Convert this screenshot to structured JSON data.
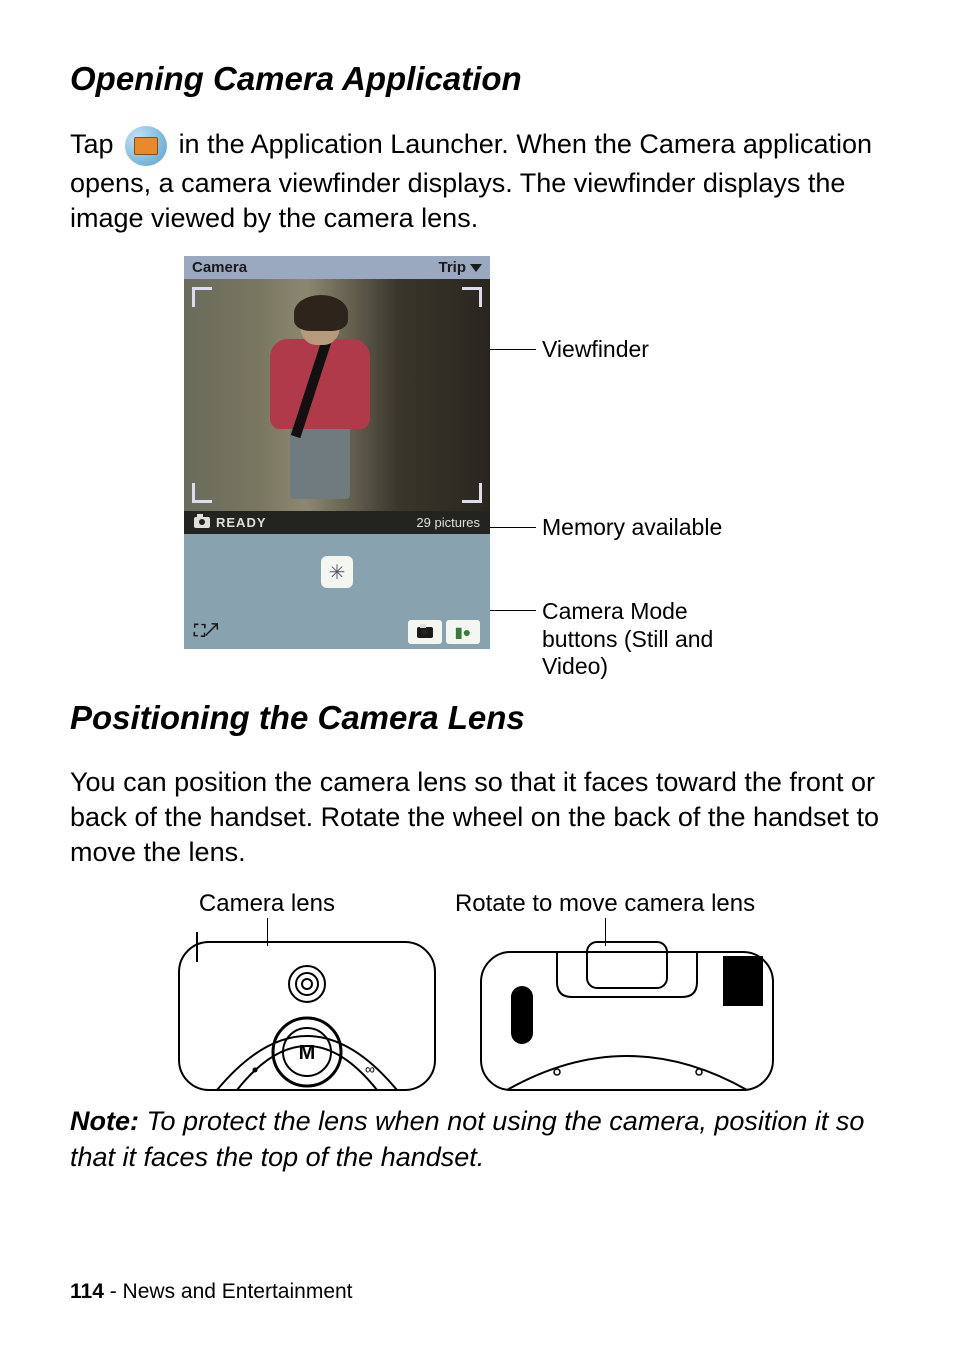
{
  "section1": {
    "heading": "Opening Camera Application",
    "para_before_icon": "Tap ",
    "para_after_icon": " in the Application Launcher. When the Camera application opens, a camera viewfinder displays. The viewfinder displays the image viewed by the camera lens."
  },
  "phone": {
    "title_left": "Camera",
    "title_right": "Trip",
    "status_left": "READY",
    "status_right": "29 pictures"
  },
  "callouts": {
    "viewfinder": "Viewfinder",
    "memory": "Memory available",
    "modes": "Camera Mode buttons (Still and Video)"
  },
  "section2": {
    "heading": "Positioning the Camera Lens",
    "para": "You can position the camera lens so that it faces toward the front or back of the handset. Rotate the wheel on the back of the handset to move the lens."
  },
  "diagram_labels": {
    "left": "Camera lens",
    "right": "Rotate to move camera lens"
  },
  "note": {
    "label": "Note:",
    "text": " To protect the lens when not using the camera, position it so that it faces the top of the handset."
  },
  "footer": {
    "page": "114",
    "chapter": " - News and Entertainment"
  }
}
